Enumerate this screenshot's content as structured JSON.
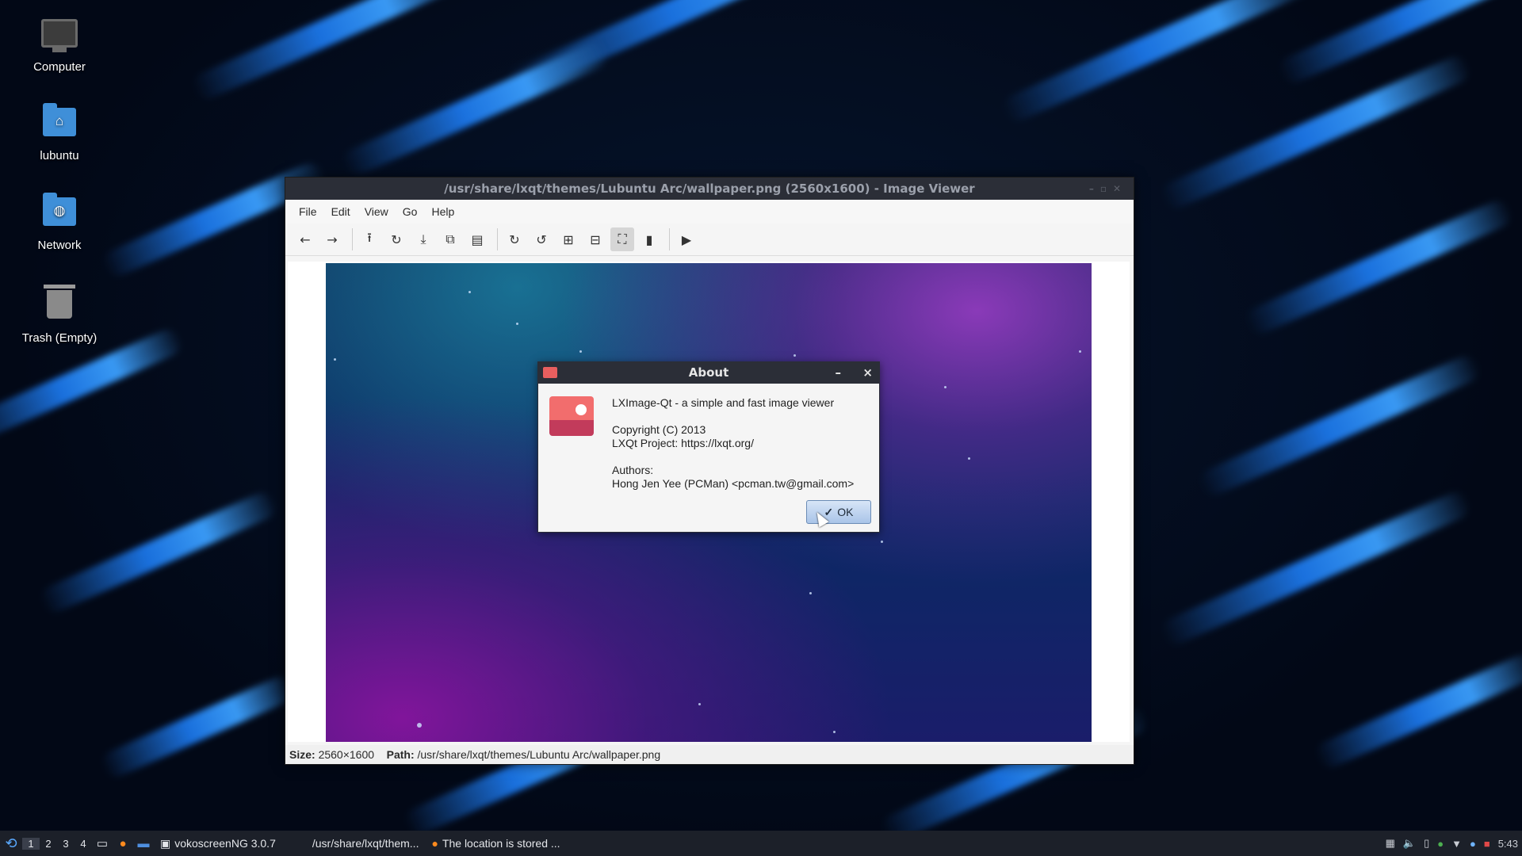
{
  "desktop": {
    "icons": [
      {
        "label": "Computer",
        "icon": "computer-icon"
      },
      {
        "label": "lubuntu",
        "icon": "home-folder-icon"
      },
      {
        "label": "Network",
        "icon": "network-folder-icon"
      },
      {
        "label": "Trash (Empty)",
        "icon": "trash-icon"
      }
    ]
  },
  "viewer": {
    "title": "/usr/share/lxqt/themes/Lubuntu Arc/wallpaper.png (2560x1600) - Image Viewer",
    "menu": [
      "File",
      "Edit",
      "View",
      "Go",
      "Help"
    ],
    "toolbar_icons": [
      "back-icon",
      "forward-icon",
      "open-icon",
      "reload-icon",
      "save-icon",
      "copy-icon",
      "paste-icon",
      "rotate-clockwise-icon",
      "rotate-counterclockwise-icon",
      "zoom-in-icon",
      "zoom-out-icon",
      "fit-window-icon",
      "original-size-icon",
      "slideshow-icon"
    ],
    "status": {
      "size_label": "Size:",
      "size_value": "2560×1600",
      "path_label": "Path:",
      "path_value": "/usr/share/lxqt/themes/Lubuntu Arc/wallpaper.png"
    }
  },
  "about": {
    "title": "About",
    "minimize": "–",
    "close": "×",
    "text": "LXImage-Qt - a simple and fast image viewer\n\nCopyright (C) 2013\nLXQt Project: https://lxqt.org/\n\nAuthors:\nHong Jen Yee (PCMan) <pcman.tw@gmail.com>",
    "ok_label": "OK"
  },
  "taskbar": {
    "desktops": [
      "1",
      "2",
      "3",
      "4"
    ],
    "tasks": [
      {
        "label": "vokoscreenNG 3.0.7"
      },
      {
        "label": "/usr/share/lxqt/them..."
      },
      {
        "label": "The location is stored ..."
      }
    ],
    "clock": "5:43"
  },
  "colors": {
    "titlebar": "#2b2e37",
    "taskbar": "#1c2029",
    "accent": "#3f8fd8"
  }
}
